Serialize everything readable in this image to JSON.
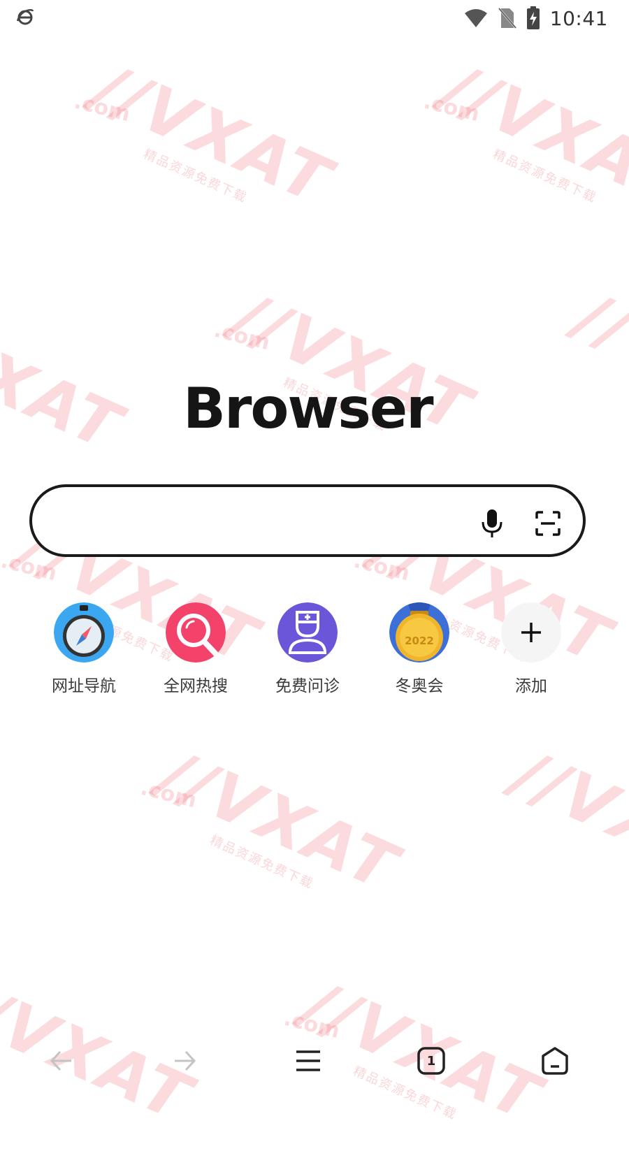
{
  "status_bar": {
    "time": "10:41",
    "left_icon": "browser-e-icon",
    "right_icons": [
      "wifi-icon",
      "no-sim-icon",
      "battery-charging-icon"
    ]
  },
  "brand": {
    "logo_text": "Browser"
  },
  "search": {
    "value": "",
    "placeholder": "",
    "voice_icon": "microphone-icon",
    "scan_icon": "scan-icon"
  },
  "shortcuts": [
    {
      "label": "网址导航",
      "icon": "compass-icon",
      "color": "#3aa7f0"
    },
    {
      "label": "全网热搜",
      "icon": "magnifier-icon",
      "color": "#f3436b"
    },
    {
      "label": "免费问诊",
      "icon": "doctor-icon",
      "color": "#6b55d8"
    },
    {
      "label": "冬奥会",
      "icon": "medal-icon",
      "color": "#f0b52a",
      "medal_text": "2022"
    },
    {
      "label": "添加",
      "icon": "plus-icon",
      "color": "#f5f5f5"
    }
  ],
  "bottom_nav": {
    "back_icon": "arrow-left-icon",
    "forward_icon": "arrow-right-icon",
    "menu_icon": "menu-icon",
    "tabs_icon": "tabs-icon",
    "tabs_count": "1",
    "home_icon": "home-icon"
  },
  "watermark": {
    "text": "VXAT",
    "domain": ".com",
    "subtitle": "精品资源免费下载",
    "color": "#ec5a69"
  }
}
